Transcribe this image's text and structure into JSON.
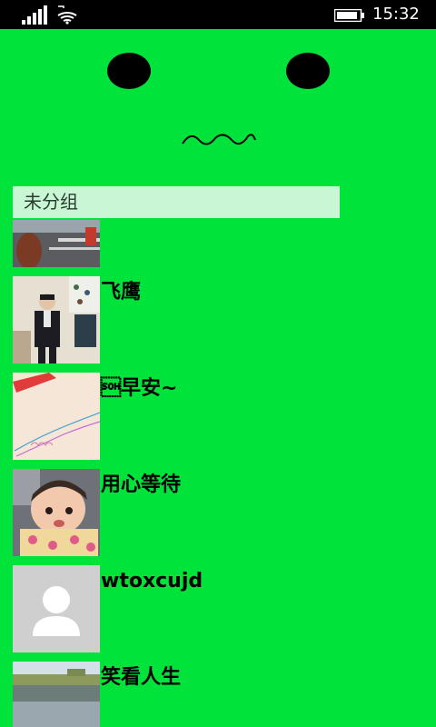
{
  "status_bar": {
    "time": "15:32",
    "icons": [
      "signal-icon",
      "wifi-icon",
      "battery-icon"
    ]
  },
  "colors": {
    "background": "#00e33a",
    "group_header_bg": "#c9f7d6",
    "status_bar_bg": "#000000"
  },
  "group": {
    "label": "未分组"
  },
  "contacts": [
    {
      "name": "",
      "avatar": "photo-street"
    },
    {
      "name": "飞鹰",
      "avatar": "photo-shop"
    },
    {
      "name": "\u0001早安~",
      "avatar": "photo-paper"
    },
    {
      "name": "用心等待",
      "avatar": "photo-baby"
    },
    {
      "name": "wtoxcujd",
      "avatar": "default-person"
    },
    {
      "name": "笑看人生",
      "avatar": "photo-lake"
    }
  ]
}
